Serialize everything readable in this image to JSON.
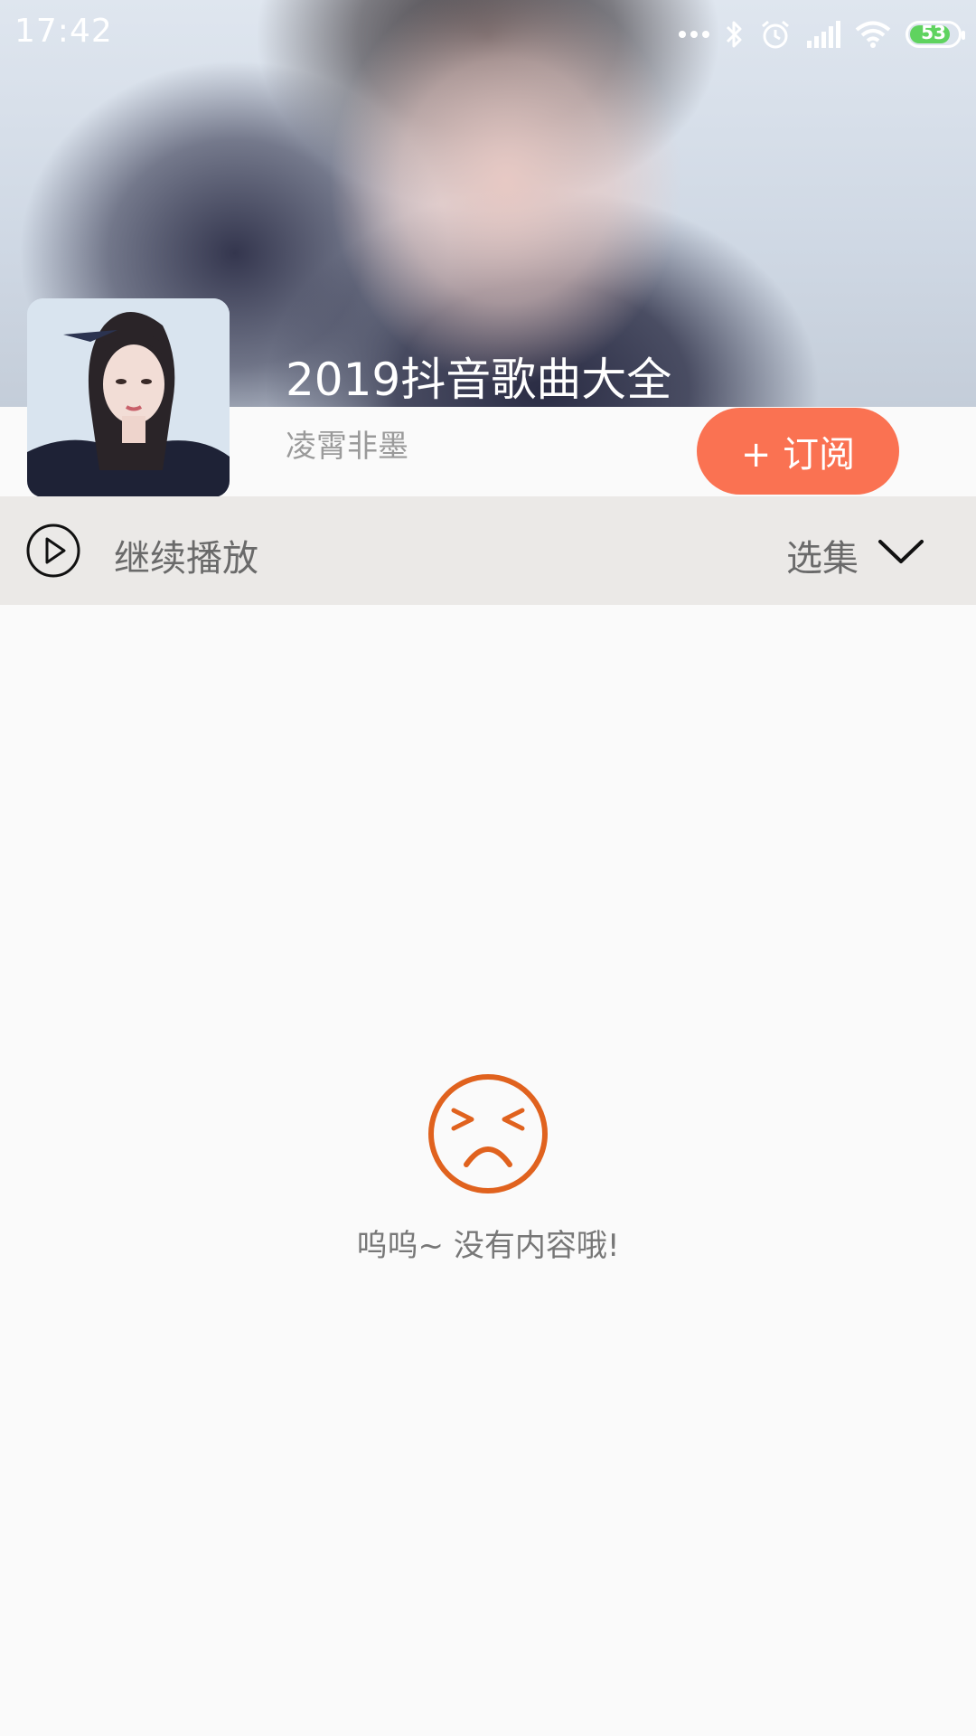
{
  "status_bar": {
    "time": "17:42",
    "battery_level": "53",
    "icons": [
      "more-dots-icon",
      "bluetooth-icon",
      "alarm-icon",
      "signal-icon",
      "wifi-icon",
      "battery-icon"
    ]
  },
  "album": {
    "title": "2019抖音歌曲大全",
    "author": "凌霄非墨",
    "subscribe_label": "+ 订阅"
  },
  "toolbar": {
    "continue_label": "继续播放",
    "select_label": "选集"
  },
  "empty_state": {
    "message": "呜呜~ 没有内容哦!"
  },
  "colors": {
    "accent": "#fa7252",
    "empty_icon": "#e0621e",
    "toolbar_bg": "#ebe9e7"
  }
}
